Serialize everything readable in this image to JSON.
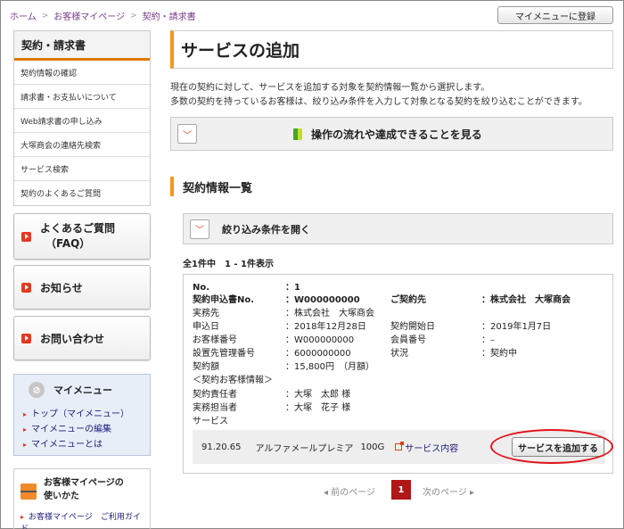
{
  "breadcrumb": [
    "ホーム",
    "お客様マイページ",
    "契約・請求書"
  ],
  "header": {
    "register_label": "マイメニューに登録"
  },
  "sidebar": {
    "title": "契約・請求書",
    "items": [
      "契約情報の確認",
      "請求書・お支払いについて",
      "Web請求書の申し込み",
      "大塚商会の連絡先検索",
      "サービス検索",
      "契約のよくあるご質問"
    ],
    "buttons": [
      {
        "line1": "よくあるご質問",
        "line2": "（FAQ）"
      },
      {
        "line1": "お知らせ"
      },
      {
        "line1": "お問い合わせ"
      }
    ],
    "my_menu": {
      "title": "マイメニュー",
      "links": [
        "トップ（マイメニュー）",
        "マイメニューの編集",
        "マイメニューとは"
      ]
    },
    "guide": {
      "title_line1": "お客様マイページの",
      "title_line2": "使いかた",
      "link": "お客様マイページ　ご利用ガイド"
    }
  },
  "main": {
    "title": "サービスの追加",
    "intro_line1": "現在の契約に対して、サービスを追加する対象を契約情報一覧から選択します。",
    "intro_line2": "多数の契約を持っているお客様は、絞り込み条件を入力して対象となる契約を絞り込むことができます。",
    "flow_label": "操作の流れや達成できることを見る",
    "section_title": "契約情報一覧",
    "filter_label": "絞り込み条件を開く",
    "count": "全1件中　1 - 1件表示",
    "contract": {
      "no_label": "No.",
      "no_value": "：1",
      "app_label": "契約申込書No.",
      "app_value": "：W000000000",
      "customer_label": "ご契約先",
      "customer_value": "：株式会社　大塚商会",
      "office_label": "実務先",
      "office_value": "：株式会社　大塚商会",
      "apply_date_label": "申込日",
      "apply_date_value": "：2018年12月28日",
      "start_date_label": "契約開始日",
      "start_date_value": "：2019年1月7日",
      "cust_no_label": "お客様番号",
      "cust_no_value": "：W000000000",
      "member_label": "会員番号",
      "member_value": "：–",
      "place_label": "設置先管理番号",
      "place_value": "：6000000000",
      "status_label": "状況",
      "status_value": "：契約中",
      "amount_label": "契約額",
      "amount_value": "：15,800円　（月額）",
      "person_header": "＜契約お客様情報＞",
      "resp_label": "契約責任者",
      "resp_value": "：大塚　太郎 様",
      "staff_label": "実務担当者",
      "staff_value": "：大塚　花子 様",
      "service_label": "サービス",
      "service": {
        "code": "91.20.65",
        "name": "アルファメールプレミア",
        "size": "100G",
        "link": "サービス内容",
        "add_button": "サービスを追加する"
      }
    },
    "pager": {
      "prev": "前のページ",
      "current": "1",
      "next": "次のページ"
    }
  },
  "colors": {
    "accent_orange": "#f09a1e",
    "brand_red": "#e03a1e",
    "highlight_ring": "#e0141a"
  }
}
